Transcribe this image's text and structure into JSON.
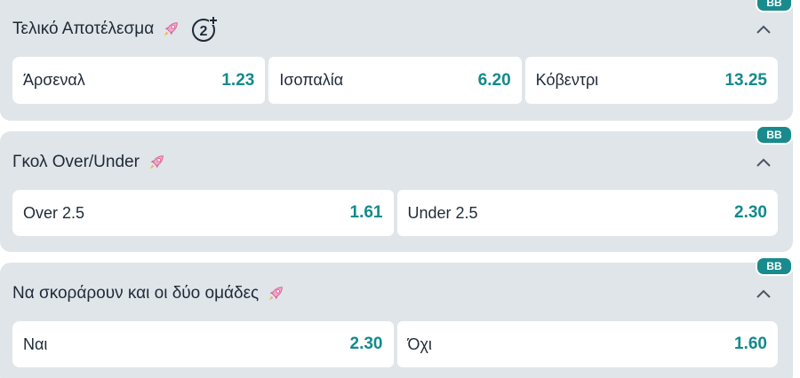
{
  "badge_label": "BB",
  "markets": [
    {
      "title": "Τελικό Αποτέλεσμα",
      "has_counter": true,
      "counter": "2",
      "outcomes": [
        {
          "label": "Άρσεναλ",
          "odds": "1.23"
        },
        {
          "label": "Ισοπαλία",
          "odds": "6.20"
        },
        {
          "label": "Κόβεντρι",
          "odds": "13.25"
        }
      ]
    },
    {
      "title": "Γκολ Over/Under",
      "outcomes": [
        {
          "label": "Over 2.5",
          "odds": "1.61"
        },
        {
          "label": "Under 2.5",
          "odds": "2.30"
        }
      ]
    },
    {
      "title": "Να σκοράρουν και οι δύο ομάδες",
      "outcomes": [
        {
          "label": "Ναι",
          "odds": "2.30"
        },
        {
          "label": "Όχι",
          "odds": "1.60"
        }
      ]
    }
  ],
  "colors": {
    "accent": "#138a8c",
    "badge": "#1a8b8d",
    "panel": "#dfe5e9",
    "text": "#1f2a37"
  },
  "icons": {
    "boost": "rocket-icon",
    "collapse": "chevron-up-icon",
    "counter": "counter-plus-icon"
  }
}
